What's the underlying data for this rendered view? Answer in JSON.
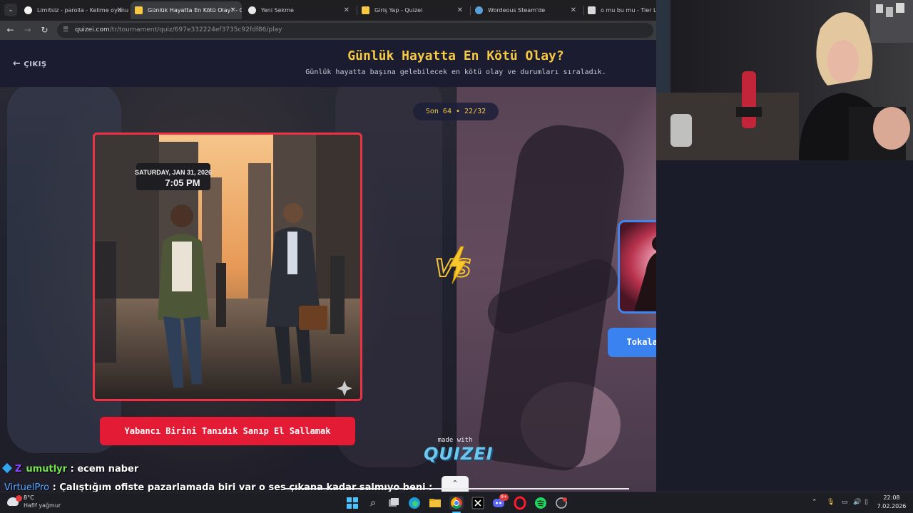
{
  "browser": {
    "tabs": [
      {
        "label": "Limitsiz - parolla - Kelime oyunu",
        "active": false
      },
      {
        "label": "Günlük Hayatta En Kötü Olay? - Quizei",
        "active": true
      },
      {
        "label": "Yeni Sekme",
        "active": false
      },
      {
        "label": "Giriş Yap - Quizei",
        "active": false
      },
      {
        "label": "Wordeous Steam'de",
        "active": false
      },
      {
        "label": "o mu bu mu - Tier List",
        "active": false
      }
    ],
    "url_host": "quizei.com",
    "url_path": "/tr/tournament/quiz/697e332224ef3735c92fdf86/play"
  },
  "quiz": {
    "exit_label": "ÇIKIŞ",
    "title": "Günlük Hayatta En Kötü Olay?",
    "subtitle": "Günlük hayatta başına gelebilecek en kötü olay ve durumları sıraladık.",
    "round": "Son 64 • 22/32",
    "left_option": {
      "label": "Yabancı Birini Tanıdık Sanıp El Sallamak",
      "sign_date": "SATURDAY, JAN 31, 2026",
      "sign_time": "7:05 PM"
    },
    "right_option": {
      "label": "Tokalaşırken Iskalamak"
    },
    "vs": "VS",
    "made_with": "made with",
    "brand": "QUIZEI"
  },
  "chat": [
    {
      "user": "umutlyr",
      "message": " : ecem naber"
    },
    {
      "user": "VirtuelPro",
      "message": " : Çalıştığım ofiste pazarlamada biri var o ses çıkana kadar salmıyo beni :"
    }
  ],
  "taskbar": {
    "weather_temp": "8°C",
    "weather_desc": "Hafif yağmur",
    "time": "22:08",
    "date": "7.02.2026",
    "notification_badge": "9+"
  },
  "colors": {
    "accent_yellow": "#f6c945",
    "left_red": "#e41b35",
    "right_blue": "#3a82f0"
  }
}
